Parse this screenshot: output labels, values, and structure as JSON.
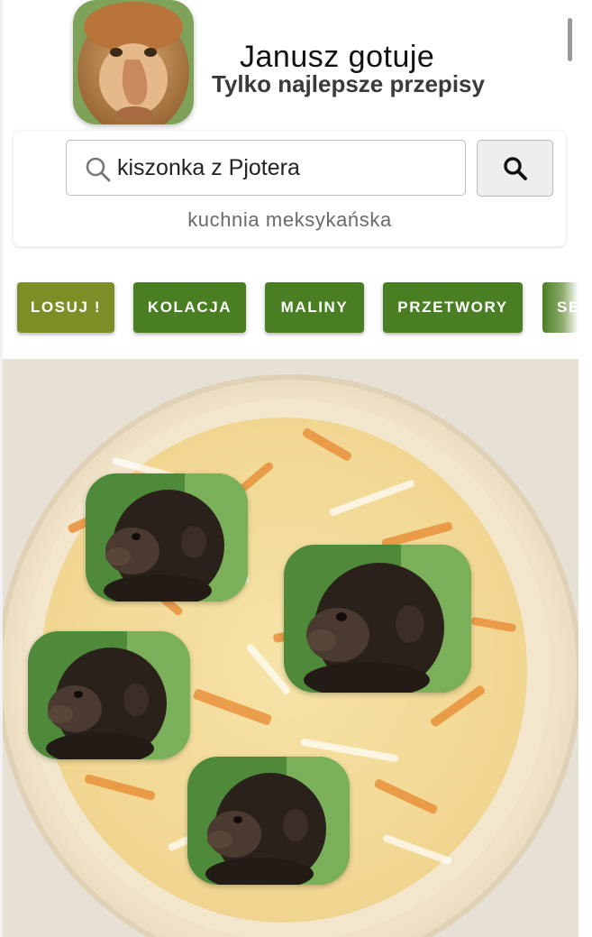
{
  "header": {
    "title": "Janusz gotuje",
    "subtitle": "Tylko najlepsze przepisy",
    "logo_icon": "proboscis-monkey-avatar"
  },
  "search": {
    "value": "kiszonka z Pjotera",
    "input_icon": "search-icon",
    "button_icon": "search-icon",
    "hint": "kuchnia meksykańska"
  },
  "chips": [
    {
      "label": "LOSUJ !",
      "color": "#7c8f26"
    },
    {
      "label": "KOLACJA",
      "color": "#4a7e23"
    },
    {
      "label": "MALINY",
      "color": "#4a7e23"
    },
    {
      "label": "PRZETWORY",
      "color": "#4a7e23"
    },
    {
      "label": "SE",
      "color": "#4a7e23"
    }
  ],
  "hero": {
    "image": "sauerkraut-salad-bowl",
    "overlays": [
      "baby-monkey-photo",
      "baby-monkey-photo",
      "baby-monkey-photo",
      "baby-monkey-photo"
    ]
  },
  "colors": {
    "accent_green": "#4a7e23",
    "accent_olive": "#7c8f26"
  }
}
